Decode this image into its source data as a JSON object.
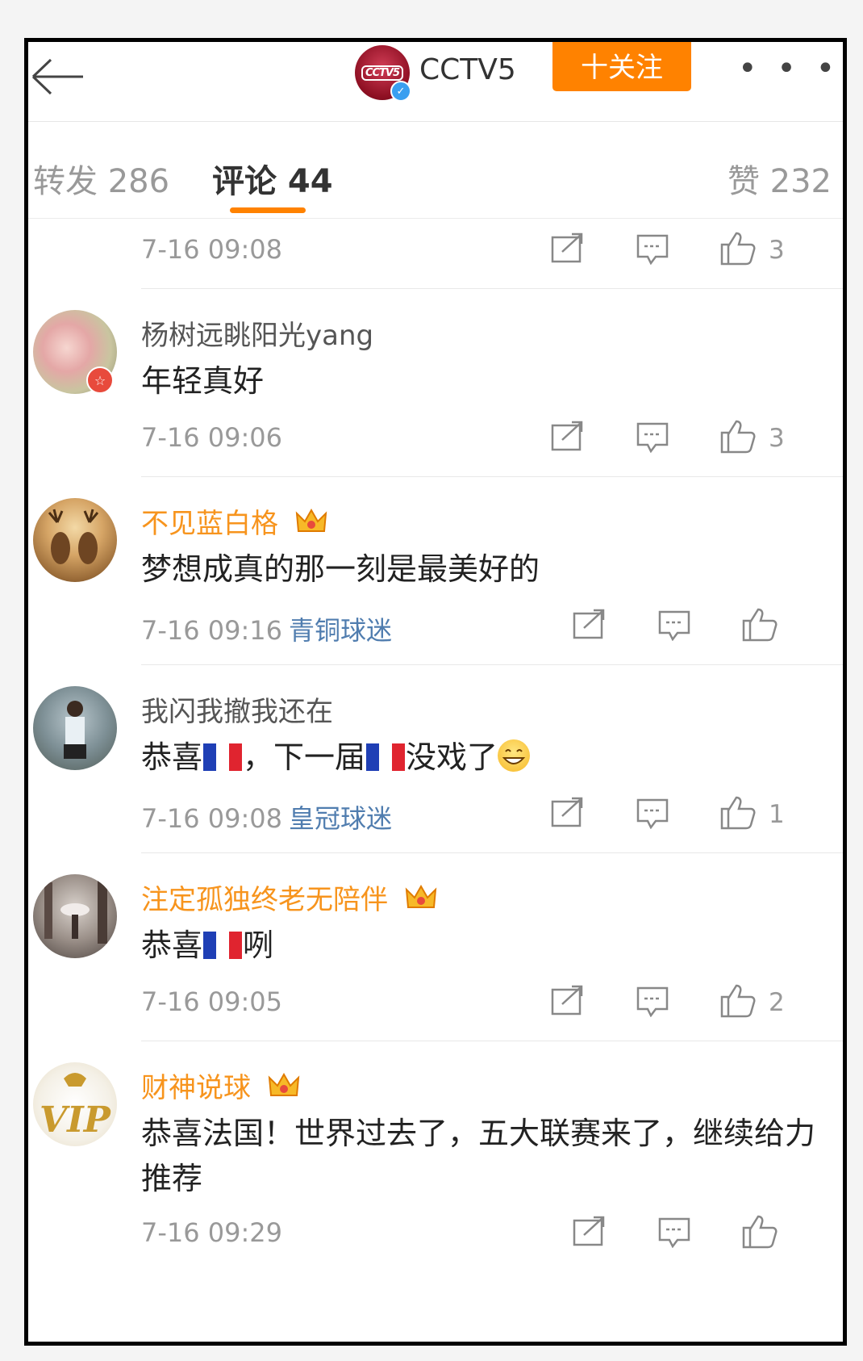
{
  "header": {
    "title": "CCTV5",
    "avatar_text": "CCTV5",
    "follow_label": "十关注",
    "more_label": "• • •"
  },
  "tabs": {
    "repost": "转发 286",
    "comments": "评论 44",
    "likes": "赞 232"
  },
  "top_row": {
    "time": "7-16 09:08",
    "likes": "3"
  },
  "comments": [
    {
      "user": "杨树远眺阳光yang",
      "text": "年轻真好",
      "time": "7-16 09:06",
      "level": "",
      "likes": "3"
    },
    {
      "user": "不见蓝白格",
      "text": "梦想成真的那一刻是最美好的",
      "time": "7-16 09:16",
      "level": "青铜球迷",
      "likes": ""
    },
    {
      "user": "我闪我撤我还在",
      "text_a": "恭喜",
      "text_b": "，下一届",
      "text_c": "没戏了",
      "time": "7-16 09:08",
      "level": "皇冠球迷",
      "likes": "1"
    },
    {
      "user": "注定孤独终老无陪伴",
      "text_a": "恭喜",
      "text_b": "咧",
      "time": "7-16 09:05",
      "level": "",
      "likes": "2"
    },
    {
      "user": "财神说球",
      "text": "恭喜法国！世界过去了，五大联赛来了，继续给力推荐",
      "time": "7-16 09:29",
      "level": "",
      "likes": ""
    }
  ],
  "colors": {
    "accent": "#ff8200",
    "vip_name": "#f7941d",
    "level_blue": "#507daf"
  },
  "icons": [
    "back-arrow-icon",
    "verified-icon",
    "more-icon",
    "share-icon",
    "reply-icon",
    "like-icon",
    "crown-icon",
    "france-flag-icon",
    "grin-emoji-icon"
  ]
}
